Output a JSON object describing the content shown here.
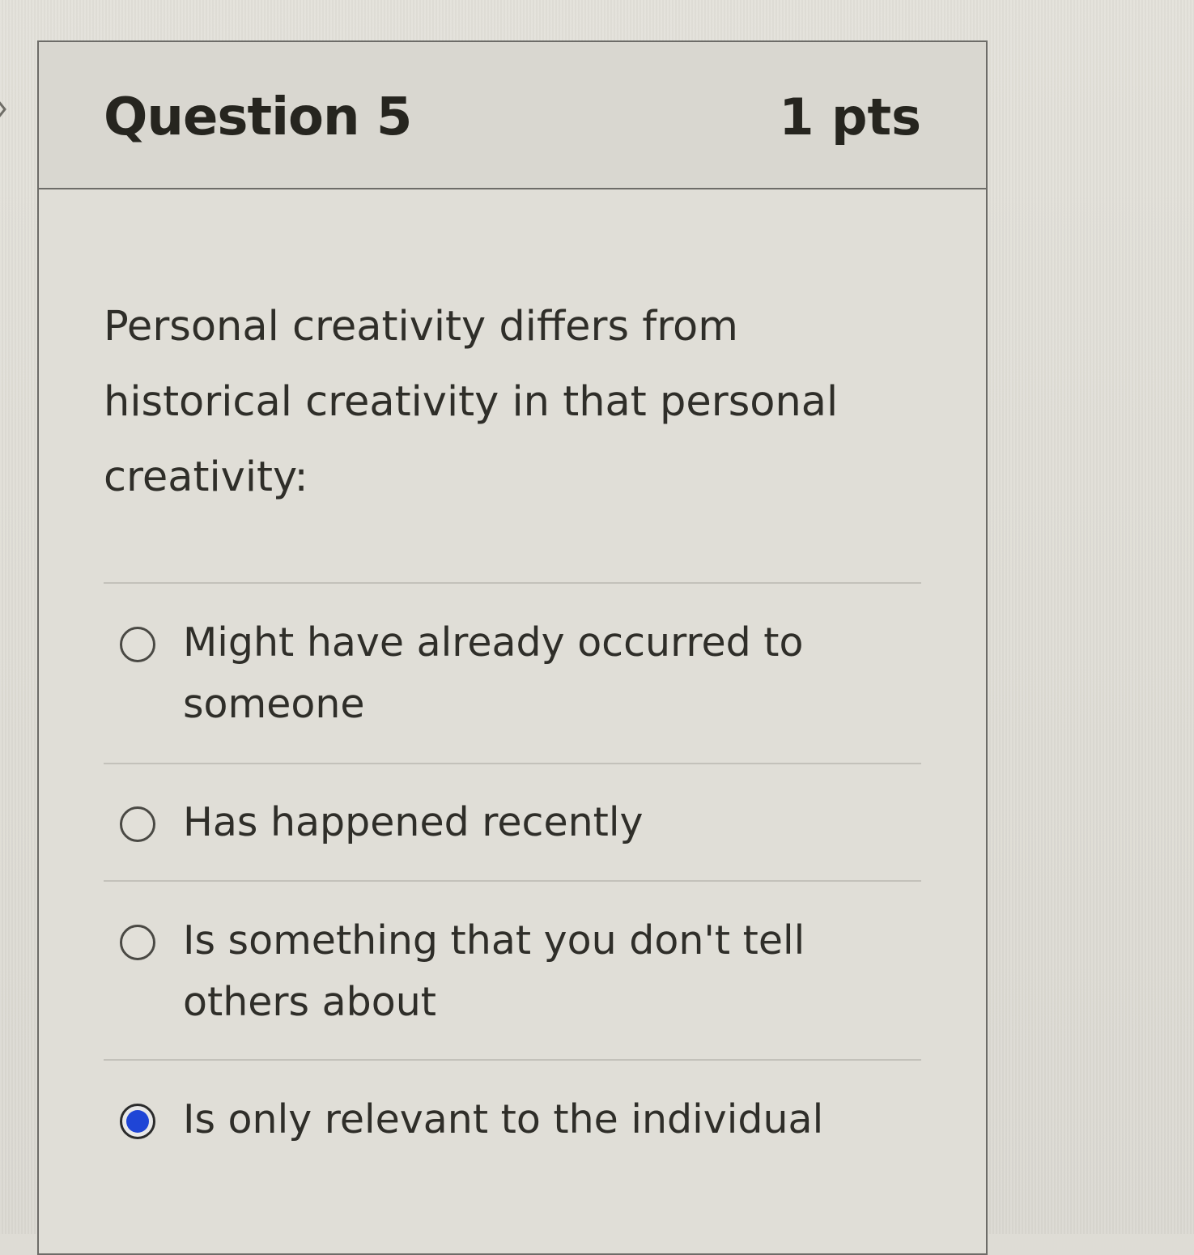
{
  "question": {
    "title": "Question 5",
    "points": "1 pts",
    "text": "Personal creativity differs from historical creativity in that personal creativity:"
  },
  "answers": [
    {
      "label": "Might have already occurred to someone",
      "selected": false
    },
    {
      "label": "Has happened recently",
      "selected": false
    },
    {
      "label": "Is something that you don't tell others about",
      "selected": false
    },
    {
      "label": "Is only relevant to the individual",
      "selected": true
    }
  ],
  "colors": {
    "selected_radio": "#1f45d6",
    "border": "#6d6c68"
  }
}
